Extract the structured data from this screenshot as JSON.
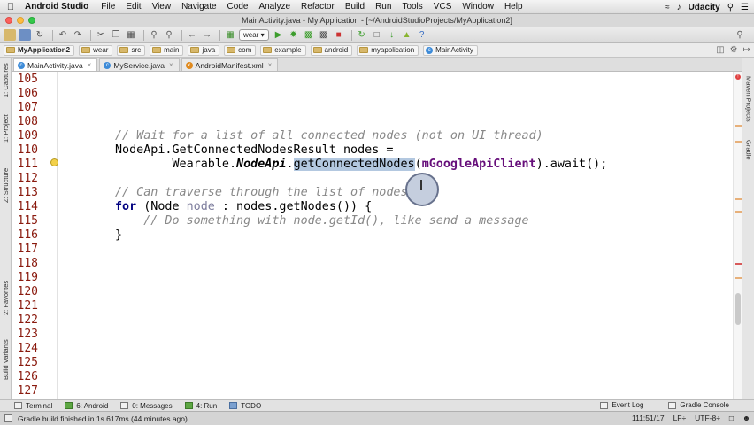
{
  "menubar": {
    "apple": "",
    "app_name": "Android Studio",
    "items": [
      "File",
      "Edit",
      "View",
      "Navigate",
      "Code",
      "Analyze",
      "Refactor",
      "Build",
      "Run",
      "Tools",
      "VCS",
      "Window",
      "Help"
    ],
    "user": "Udacity"
  },
  "window": {
    "title": "MainActivity.java - My Application - [~/AndroidStudioProjects/MyApplication2]"
  },
  "toolbar": {
    "run_config": "wear"
  },
  "breadcrumbs": [
    "MyApplication2",
    "wear",
    "src",
    "main",
    "java",
    "com",
    "example",
    "android",
    "myapplication",
    "MainActivity"
  ],
  "sidebar_left": [
    "1: Captures",
    "1: Project",
    "Z: Structure",
    "2: Favorites",
    "Build Variants"
  ],
  "sidebar_right": [
    "Maven Projects",
    "Gradle"
  ],
  "tabs": [
    {
      "label": "MainActivity.java",
      "icon_color": "#3d8bd8",
      "active": true
    },
    {
      "label": "MyService.java",
      "icon_color": "#3d8bd8",
      "active": false
    },
    {
      "label": "AndroidManifest.xml",
      "icon_color": "#e08a1e",
      "active": false
    }
  ],
  "editor": {
    "line_numbers": [
      "105",
      "106",
      "107",
      "108",
      "109",
      "110",
      "111",
      "112",
      "113",
      "114",
      "115",
      "116",
      "117",
      "118",
      "119",
      "120",
      "121",
      "122",
      "123",
      "124",
      "125",
      "126",
      "127"
    ],
    "code": {
      "l109_comment": "// Wait for a list of all connected nodes (not on UI thread)",
      "l110_type": "NodeApi.GetConnectedNodesResult",
      "l110_rest": " nodes =",
      "l111_indent": "        ",
      "l111_a": "Wearable.",
      "l111_b": "NodeApi",
      "l111_c": ".",
      "l111_sel": "getConnectedNodes",
      "l111_d": "(",
      "l111_e": "mGoogleApiClient",
      "l111_f": ").await();",
      "l113_comment": "// Can traverse through the list of nodes",
      "l114_kw": "for",
      "l114_a": " (Node ",
      "l114_var": "node",
      "l114_b": " : nodes.getNodes()) {",
      "l115_comment": "    // Do something with node.getId(), like send a message",
      "l116": "}"
    }
  },
  "tool_windows": {
    "left": [
      "Terminal",
      "6: Android",
      "0: Messages",
      "4: Run",
      "TODO"
    ],
    "right": [
      "Event Log",
      "Gradle Console"
    ]
  },
  "status": {
    "message": "Gradle build finished in 1s 617ms (44 minutes ago)",
    "position": "111:51/17",
    "line_sep": "LF÷",
    "encoding": "UTF-8÷"
  },
  "colors": {
    "line_number": "#8a1a0e",
    "keyword": "#000080",
    "comment": "#888888",
    "selection": "#b3c8e0"
  }
}
